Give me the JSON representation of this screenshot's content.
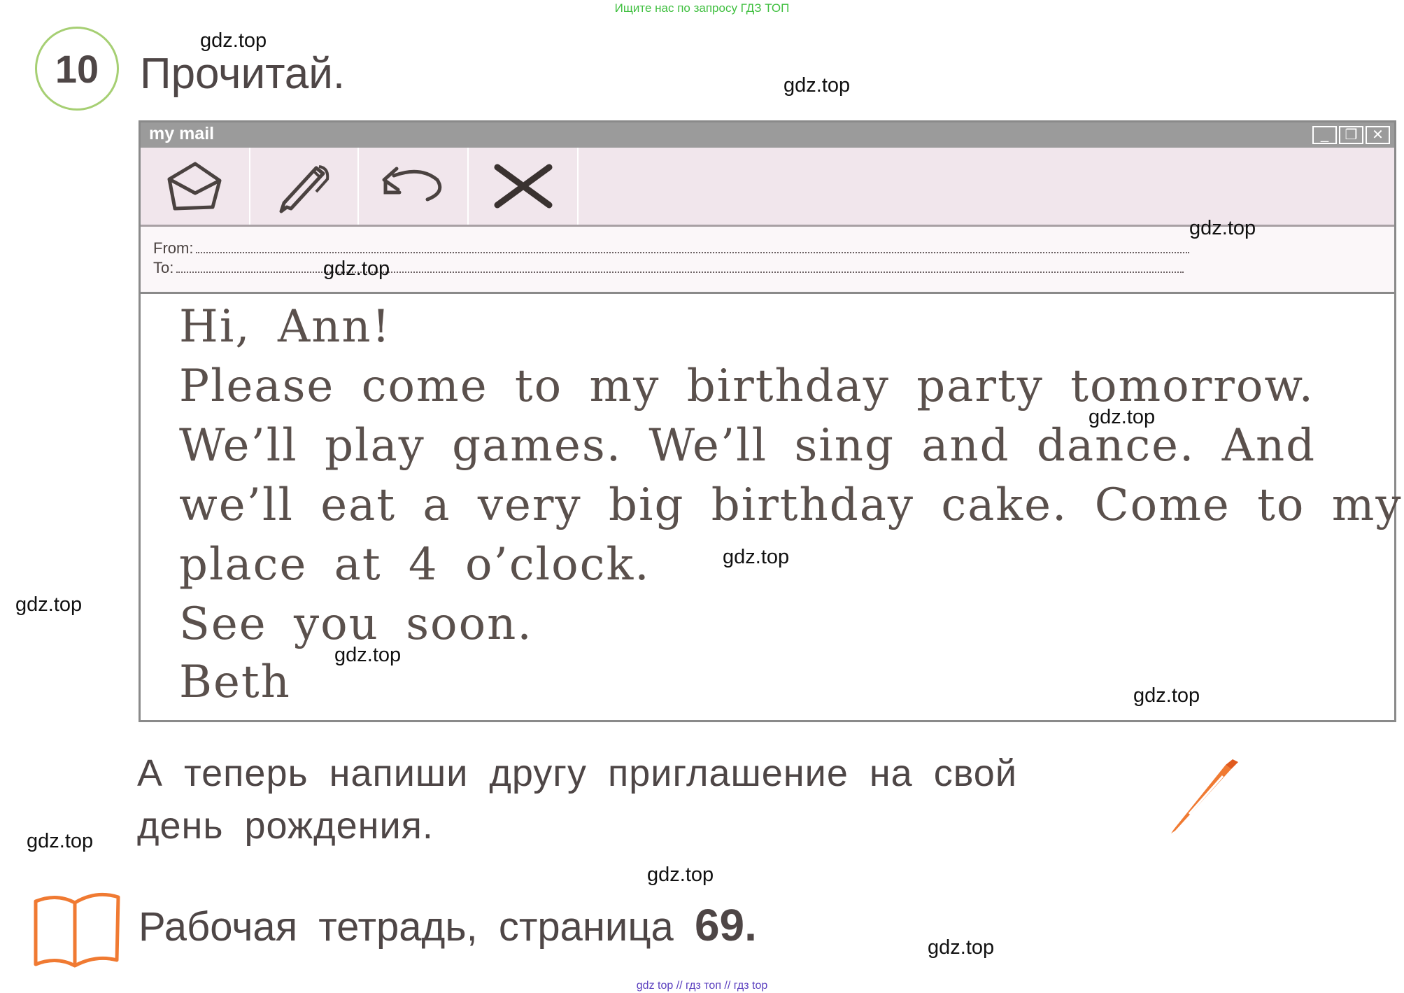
{
  "banner": "Ищите нас по запросу ГДЗ ТОП",
  "task": {
    "number": "10",
    "title": "Прочитай."
  },
  "mail_window": {
    "title": "my mail",
    "controls": [
      "minimize-icon",
      "restore-icon",
      "close-icon"
    ],
    "toolbar": [
      {
        "icon": "envelope-icon",
        "label": "open mail"
      },
      {
        "icon": "pen-icon",
        "label": "write"
      },
      {
        "icon": "reply-arrow-icon",
        "label": "reply"
      },
      {
        "icon": "delete-x-icon",
        "label": "delete"
      }
    ],
    "from_label": "From:",
    "to_label": "To:",
    "letter": {
      "greeting": "Hi, Ann!",
      "line1": "Please come to my birthday party tomorrow.",
      "line2": "We’ll play games. We’ll sing and dance. And",
      "line3": "we’ll eat a very big birthday cake. Come to my",
      "line4": "place at 4 o’clock.",
      "closing": "See you soon.",
      "signature": "Beth"
    }
  },
  "instruction": {
    "line1": "А теперь напиши другу приглашение на свой",
    "line2": "день рождения."
  },
  "workbook": {
    "text": "Рабочая тетрадь, страница",
    "page": "69."
  },
  "watermark": "gdz.top",
  "footer": "gdz top // гдз топ // гдз top"
}
